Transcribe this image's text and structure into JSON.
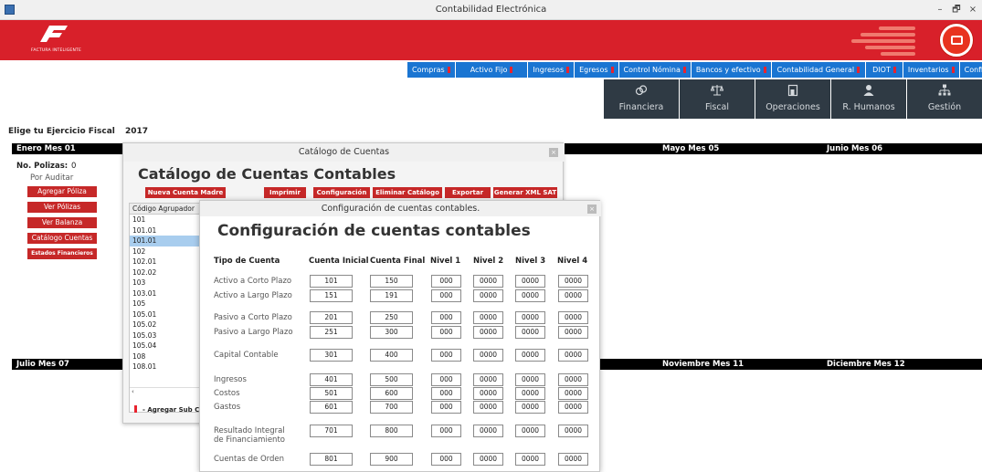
{
  "window": {
    "title": "Contabilidad Electrónica",
    "controls": [
      "–",
      "🗗",
      "×"
    ]
  },
  "banner": {
    "logo_text": "FACTURA INTELIGENTE"
  },
  "menu": [
    {
      "label": "Compras",
      "flag": true
    },
    {
      "label": "Activo Fijo",
      "flag": true
    },
    {
      "label": "Ingresos",
      "flag": true
    },
    {
      "label": "Egresos",
      "flag": true
    },
    {
      "label": "Control Nómina",
      "flag": true
    },
    {
      "label": "Bancos y efectivo",
      "flag": true
    },
    {
      "label": "Contabilidad General",
      "flag": true
    },
    {
      "label": "DIOT",
      "flag": true
    },
    {
      "label": "Inventarios",
      "flag": true
    },
    {
      "label": "Configuración",
      "flag": false
    }
  ],
  "modules": [
    {
      "label": "Financiera",
      "icon": "coins-icon"
    },
    {
      "label": "Fiscal",
      "icon": "balance-scale-icon"
    },
    {
      "label": "Operaciones",
      "icon": "clipboard-icon"
    },
    {
      "label": "R. Humanos",
      "icon": "person-icon"
    },
    {
      "label": "Gestión",
      "icon": "org-chart-icon"
    }
  ],
  "fiscal_year": {
    "label": "Elige tu Ejercicio Fiscal",
    "value": "2017"
  },
  "months_top": [
    "Enero Mes 01",
    "Mayo Mes 05",
    "Junio Mes 06"
  ],
  "months_bottom": [
    "Julio Mes 07",
    "Noviembre Mes 11",
    "Diciembre Mes 12"
  ],
  "polizas": {
    "label": "No. Polizas:",
    "count": "0",
    "status": "Por Auditar",
    "buttons": [
      "Agregar Póliza",
      "Ver Pólizas",
      "Ver Balanza",
      "Catálogo Cuentas",
      "Estados Financieros"
    ]
  },
  "catalog": {
    "window_title": "Catálogo de Cuentas",
    "heading": "Catálogo de Cuentas Contables",
    "buttons": [
      "Nueva Cuenta Madre",
      "Imprimir",
      "Configuración",
      "Eliminar Catálogo",
      "Exportar",
      "Generar XML SAT"
    ],
    "tree_header": "Código Agrupador",
    "tree_rows": [
      "101",
      "101.01",
      "101.01",
      "102",
      "102.01",
      "102.02",
      "103",
      "103.01",
      "105",
      "105.01",
      "105.02",
      "105.03",
      "105.04",
      "108",
      "108.01"
    ],
    "selected_index": 2,
    "add_sub_label": "- Agregar Sub Cu"
  },
  "config": {
    "window_title": "Configuración de cuentas contables.",
    "heading": "Configuración de cuentas contables",
    "columns": [
      "Tipo de Cuenta",
      "Cuenta Inicial",
      "Cuenta Final",
      "Nivel 1",
      "Nivel 2",
      "Nivel 3",
      "Nivel 4"
    ],
    "rows": [
      {
        "tipo": "Activo a Corto Plazo",
        "inicial": "101",
        "final": "150",
        "n1": "000",
        "n2": "0000",
        "n3": "0000",
        "n4": "0000"
      },
      {
        "tipo": "Activo a Largo Plazo",
        "inicial": "151",
        "final": "191",
        "n1": "000",
        "n2": "0000",
        "n3": "0000",
        "n4": "0000"
      },
      {
        "tipo": "Pasivo a Corto Plazo",
        "inicial": "201",
        "final": "250",
        "n1": "000",
        "n2": "0000",
        "n3": "0000",
        "n4": "0000"
      },
      {
        "tipo": "Pasivo a Largo Plazo",
        "inicial": "251",
        "final": "300",
        "n1": "000",
        "n2": "0000",
        "n3": "0000",
        "n4": "0000"
      },
      {
        "tipo": "Capital Contable",
        "inicial": "301",
        "final": "400",
        "n1": "000",
        "n2": "0000",
        "n3": "0000",
        "n4": "0000"
      },
      {
        "tipo": "Ingresos",
        "inicial": "401",
        "final": "500",
        "n1": "000",
        "n2": "0000",
        "n3": "0000",
        "n4": "0000"
      },
      {
        "tipo": "Costos",
        "inicial": "501",
        "final": "600",
        "n1": "000",
        "n2": "0000",
        "n3": "0000",
        "n4": "0000"
      },
      {
        "tipo": "Gastos",
        "inicial": "601",
        "final": "700",
        "n1": "000",
        "n2": "0000",
        "n3": "0000",
        "n4": "0000"
      },
      {
        "tipo": "Resultado Integral de Financiamiento",
        "inicial": "701",
        "final": "800",
        "n1": "000",
        "n2": "0000",
        "n3": "0000",
        "n4": "0000"
      },
      {
        "tipo": "Cuentas de Orden",
        "inicial": "801",
        "final": "900",
        "n1": "000",
        "n2": "0000",
        "n3": "0000",
        "n4": "0000"
      }
    ]
  },
  "colors": {
    "brand_red": "#d8202a",
    "menu_blue": "#1a75d2",
    "module_dark": "#2f3a44",
    "button_red": "#c62828",
    "selection_blue": "#a8cdee"
  }
}
